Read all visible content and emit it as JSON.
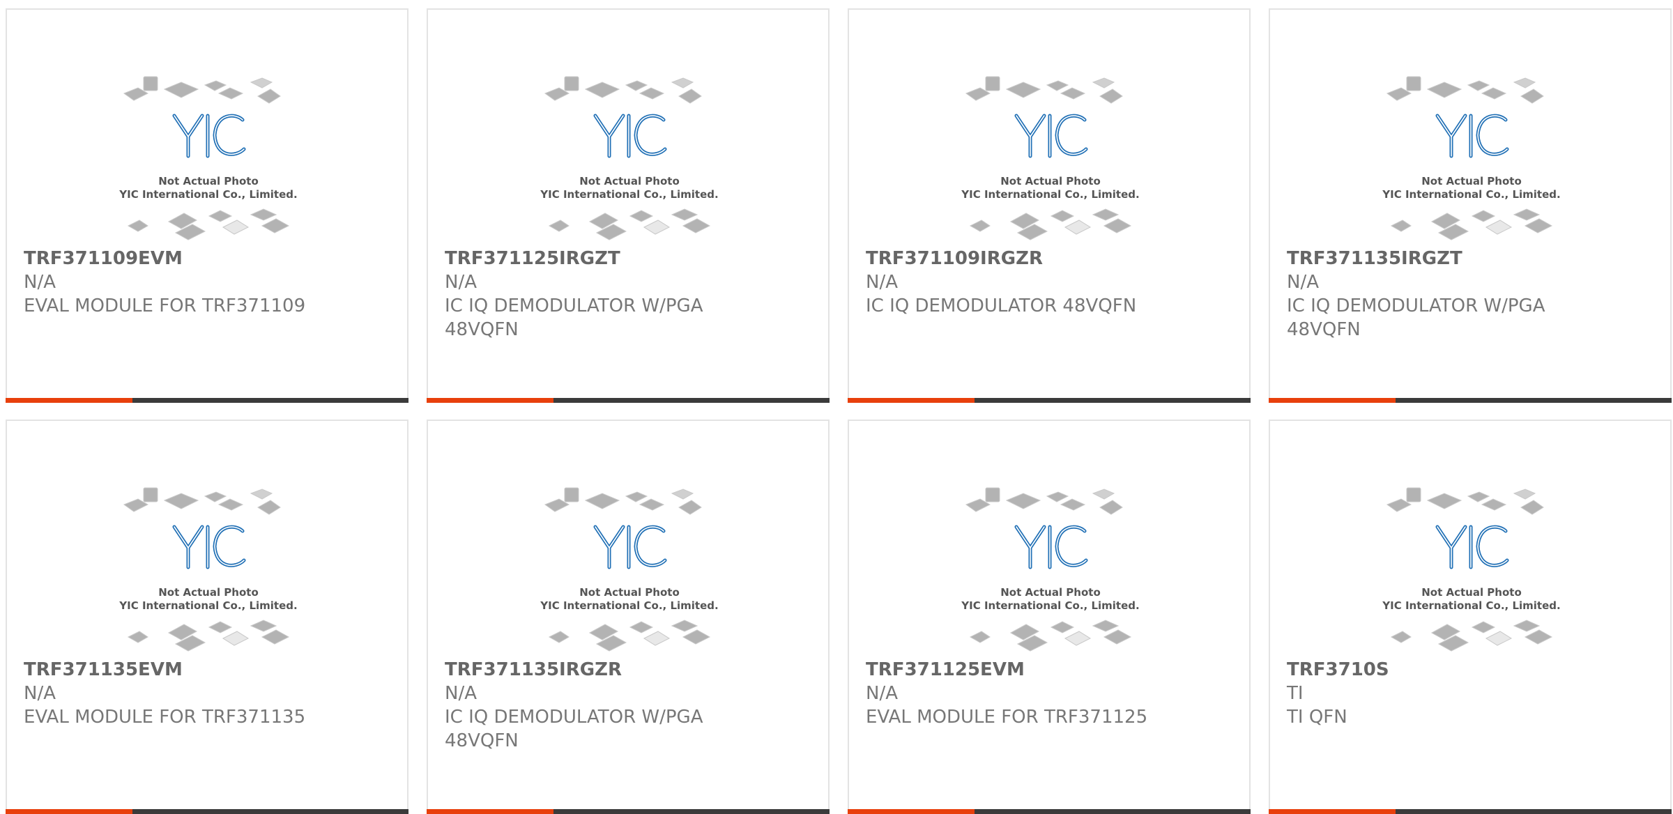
{
  "watermark": {
    "logo_text": "YIC",
    "line1": "Not Actual Photo",
    "line2": "YIC International Co., Limited."
  },
  "colors": {
    "accent": "#e8400c",
    "bar": "#3b3b3b",
    "logo": "#1f6fb5"
  },
  "products": [
    {
      "part_number": "TRF371109EVM",
      "manufacturer": "N/A",
      "description": "EVAL MODULE FOR TRF371109"
    },
    {
      "part_number": "TRF371125IRGZT",
      "manufacturer": "N/A",
      "description": "IC IQ DEMODULATOR W/PGA 48VQFN"
    },
    {
      "part_number": "TRF371109IRGZR",
      "manufacturer": "N/A",
      "description": "IC IQ DEMODULATOR 48VQFN"
    },
    {
      "part_number": "TRF371135IRGZT",
      "manufacturer": "N/A",
      "description": "IC IQ DEMODULATOR W/PGA 48VQFN"
    },
    {
      "part_number": "TRF371135EVM",
      "manufacturer": "N/A",
      "description": "EVAL MODULE FOR TRF371135"
    },
    {
      "part_number": "TRF371135IRGZR",
      "manufacturer": "N/A",
      "description": "IC IQ DEMODULATOR W/PGA 48VQFN"
    },
    {
      "part_number": "TRF371125EVM",
      "manufacturer": "N/A",
      "description": "EVAL MODULE FOR TRF371125"
    },
    {
      "part_number": "TRF3710S",
      "manufacturer": "TI",
      "description": "TI QFN"
    }
  ]
}
